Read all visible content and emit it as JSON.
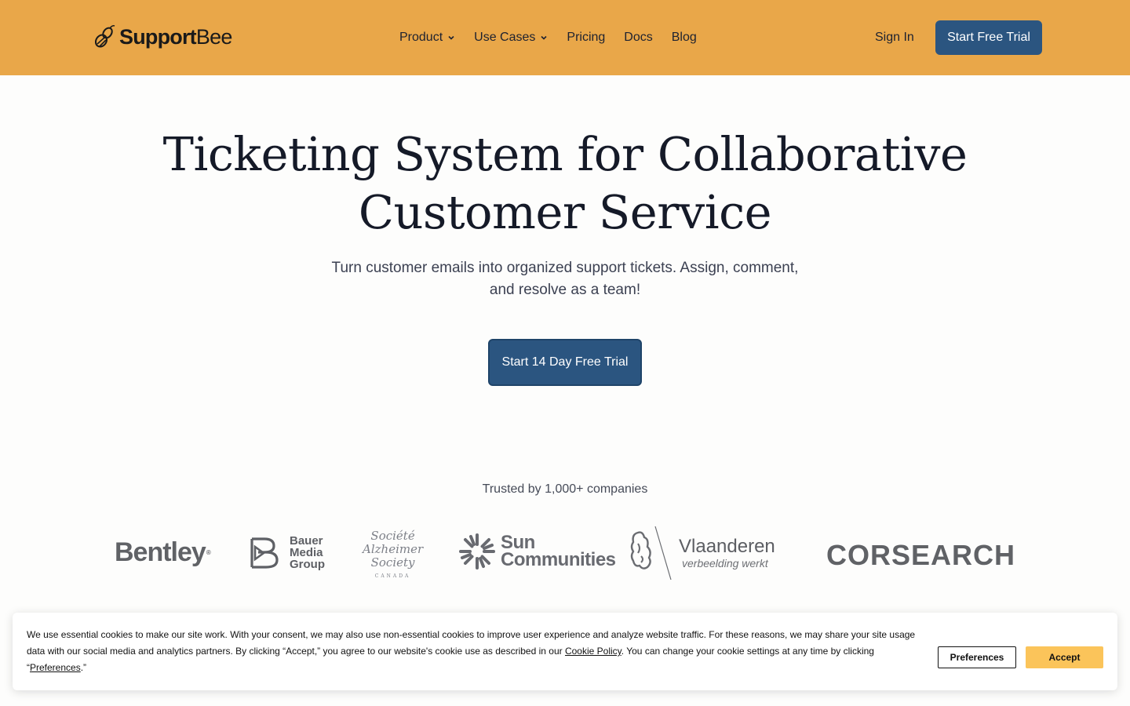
{
  "header": {
    "logo_bold": "Support",
    "logo_light": "Bee",
    "nav": [
      {
        "label": "Product",
        "dropdown": true
      },
      {
        "label": "Use Cases",
        "dropdown": true
      },
      {
        "label": "Pricing",
        "dropdown": false
      },
      {
        "label": "Docs",
        "dropdown": false
      },
      {
        "label": "Blog",
        "dropdown": false
      }
    ],
    "sign_in": "Sign In",
    "cta": "Start Free Trial",
    "bg_color": "#e9a749",
    "cta_color": "#2b5580"
  },
  "hero": {
    "title": "Ticketing System for Collaborative Customer Service",
    "subtitle": "Turn customer emails into organized support tickets. Assign, comment, and resolve as a team!",
    "cta": "Start 14 Day Free Trial"
  },
  "trusted": {
    "label": "Trusted by 1,000+ companies",
    "logos": {
      "bentley": "Bentley",
      "bauer": [
        "Bauer",
        "Media",
        "Group"
      ],
      "alzheimer": [
        "Société",
        "Alzheimer",
        "Society",
        "CANADA"
      ],
      "sun": [
        "Sun",
        "Communities"
      ],
      "vlaanderen": [
        "Vlaanderen",
        "verbeelding werkt"
      ],
      "corsearch": "CORSEARCH"
    }
  },
  "cookie_banner": {
    "text_part1": "We use essential cookies to make our site work. With your consent, we may also use non-essential cookies to improve user experience and analyze website traffic. For these reasons, we may share your site usage data with our social media and analytics partners. By clicking “Accept,” you agree to our website's cookie use as described in our ",
    "cookie_policy_link": "Cookie Policy",
    "text_part2": ". You can change your cookie settings at any time by clicking “",
    "preferences_link": "Preferences",
    "text_part3": ".”",
    "preferences_button": "Preferences",
    "accept_button": "Accept",
    "accept_color": "#fbc45a"
  }
}
